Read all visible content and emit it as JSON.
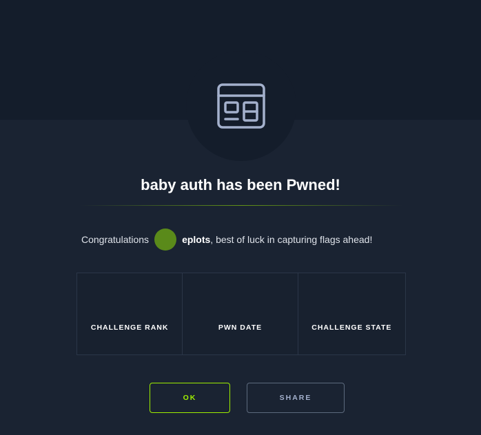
{
  "modal": {
    "title": "baby auth has been Pwned!",
    "congrats_prefix": "Congratulations",
    "username": "eplots",
    "congrats_suffix": ", best of luck in capturing flags ahead!",
    "icon": "browser-window-icon",
    "avatar_color": "#5a8a1a",
    "accent_color": "#9fef00"
  },
  "stats": [
    {
      "label": "CHALLENGE RANK"
    },
    {
      "label": "PWN DATE"
    },
    {
      "label": "CHALLENGE STATE"
    }
  ],
  "buttons": {
    "ok_label": "OK",
    "share_label": "SHARE"
  }
}
